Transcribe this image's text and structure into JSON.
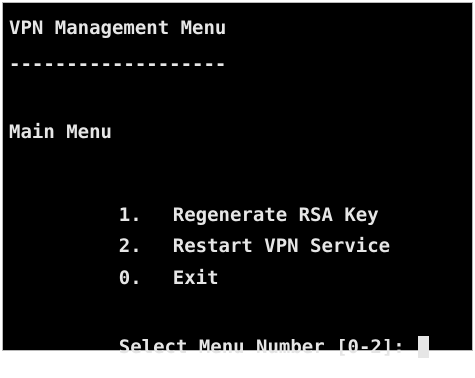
{
  "terminal": {
    "title": "VPN Management Menu",
    "underline": "-------------------",
    "section": "Main Menu",
    "menu": [
      {
        "number": "1.",
        "label": "Regenerate RSA Key"
      },
      {
        "number": "2.",
        "label": "Restart VPN Service"
      },
      {
        "number": "0.",
        "label": "Exit"
      }
    ],
    "prompt": "Select Menu Number [0-2]:"
  }
}
